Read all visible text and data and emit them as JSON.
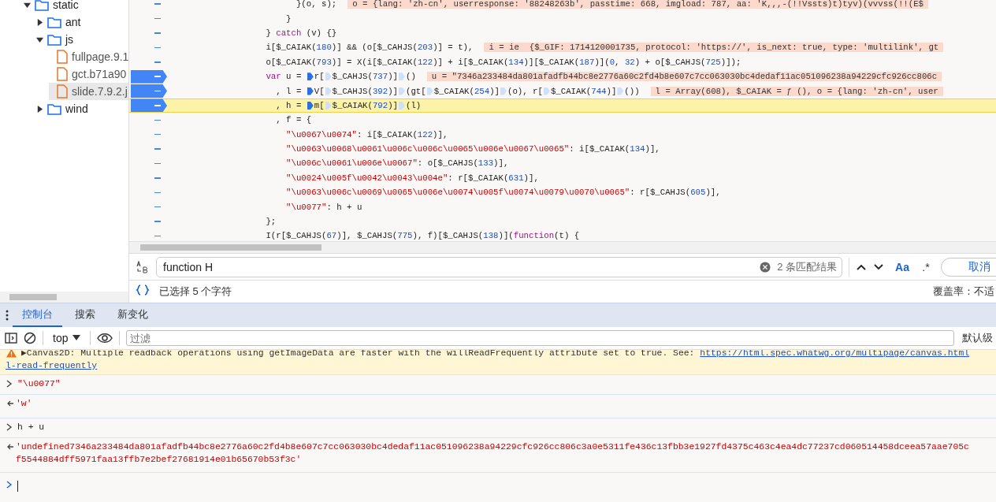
{
  "file_tree": [
    {
      "name": "static",
      "kind": "folder",
      "expanded": true,
      "children": [
        {
          "name": "ant",
          "kind": "folder",
          "expanded": false
        },
        {
          "name": "js",
          "kind": "folder",
          "expanded": true,
          "children": [
            {
              "name": "fullpage.9.1",
              "kind": "file",
              "selected": false
            },
            {
              "name": "gct.b71a90",
              "kind": "file",
              "selected": false
            },
            {
              "name": "slide.7.9.2.j",
              "kind": "file",
              "selected": true
            }
          ]
        },
        {
          "name": "wind",
          "kind": "folder",
          "expanded": false
        }
      ]
    }
  ],
  "code_lines": [
    {
      "tokens": [
        {
          "kind": "text",
          "text": "                        }(o, s);"
        }
      ],
      "inline": "o = {lang: 'zh-cn', userresponse: '88248263b', passtime: 668, imgload: 787, aa: 'K,,,-(!!Vssts)t)tyv)(vvvss(!!(E$",
      "breakpoint": false,
      "highlighted": false
    },
    {
      "tokens": [
        {
          "kind": "text",
          "text": "                      }"
        }
      ],
      "breakpoint": false,
      "highlighted": false
    },
    {
      "tokens": [
        {
          "kind": "text",
          "text": "                  } "
        },
        {
          "kind": "keyword",
          "text": "catch"
        },
        {
          "kind": "text",
          "text": " (v) {}"
        }
      ],
      "breakpoint": false,
      "highlighted": false
    },
    {
      "tokens": [
        {
          "kind": "text",
          "text": "                  i[$_CAIAK("
        },
        {
          "kind": "number",
          "text": "180"
        },
        {
          "kind": "text",
          "text": ")] && (o[$_CAHJS("
        },
        {
          "kind": "number",
          "text": "203"
        },
        {
          "kind": "text",
          "text": ")] = t),"
        }
      ],
      "inline": "i = ie  {$_GIF: 1714120001735, protocol: 'https://', is_next: true, type: 'multilink', gt",
      "breakpoint": false,
      "highlighted": false
    },
    {
      "tokens": [
        {
          "kind": "text",
          "text": "                  o[$_CAIAK("
        },
        {
          "kind": "number",
          "text": "793"
        },
        {
          "kind": "text",
          "text": ")] = X(i[$_CAIAK("
        },
        {
          "kind": "number",
          "text": "122"
        },
        {
          "kind": "text",
          "text": ")] + i[$_CAIAK("
        },
        {
          "kind": "number",
          "text": "134"
        },
        {
          "kind": "text",
          "text": ")][$_CAIAK("
        },
        {
          "kind": "number",
          "text": "187"
        },
        {
          "kind": "text",
          "text": ")]("
        },
        {
          "kind": "number",
          "text": "0"
        },
        {
          "kind": "text",
          "text": ", "
        },
        {
          "kind": "number",
          "text": "32"
        },
        {
          "kind": "text",
          "text": ") + o[$_CAHJS("
        },
        {
          "kind": "number",
          "text": "725"
        },
        {
          "kind": "text",
          "text": ")]);"
        }
      ],
      "breakpoint": false,
      "highlighted": false
    },
    {
      "tokens": [
        {
          "kind": "keyword",
          "text": "                  var"
        },
        {
          "kind": "text",
          "text": " u = "
        },
        {
          "kind": "step"
        },
        {
          "kind": "text",
          "text": "r["
        },
        {
          "kind": "call-step"
        },
        {
          "kind": "text",
          "text": "$_CAHJS("
        },
        {
          "kind": "number",
          "text": "737"
        },
        {
          "kind": "text",
          "text": ")]"
        },
        {
          "kind": "call-step"
        },
        {
          "kind": "text",
          "text": "()"
        }
      ],
      "inline": "u = \"7346a233484da801afadfb44bc8e2776a60c2fd4b8e607c7cc063030bc4dedaf11ac051096238a94229cfc926cc806c",
      "breakpoint": true,
      "highlighted": false
    },
    {
      "tokens": [
        {
          "kind": "text",
          "text": "                    , l = "
        },
        {
          "kind": "step"
        },
        {
          "kind": "text",
          "text": "V["
        },
        {
          "kind": "call-step"
        },
        {
          "kind": "text",
          "text": "$_CAHJS("
        },
        {
          "kind": "number",
          "text": "392"
        },
        {
          "kind": "text",
          "text": ")]"
        },
        {
          "kind": "call-step"
        },
        {
          "kind": "text",
          "text": "(gt["
        },
        {
          "kind": "call-step"
        },
        {
          "kind": "text",
          "text": "$_CAIAK("
        },
        {
          "kind": "number",
          "text": "254"
        },
        {
          "kind": "text",
          "text": ")]"
        },
        {
          "kind": "call-step"
        },
        {
          "kind": "text",
          "text": "(o), r["
        },
        {
          "kind": "call-step"
        },
        {
          "kind": "text",
          "text": "$_CAIAK("
        },
        {
          "kind": "number",
          "text": "744"
        },
        {
          "kind": "text",
          "text": ")]"
        },
        {
          "kind": "call-step"
        },
        {
          "kind": "text",
          "text": "())"
        }
      ],
      "inline": "l = Array(608), $_CAIAK = ƒ (), o = {lang: 'zh-cn', user",
      "breakpoint": true,
      "highlighted": false
    },
    {
      "tokens": [
        {
          "kind": "text",
          "text": "                    , h = "
        },
        {
          "kind": "step"
        },
        {
          "kind": "text",
          "text": "m["
        },
        {
          "kind": "call-step"
        },
        {
          "kind": "text",
          "text": "$_CAIAK("
        },
        {
          "kind": "number",
          "text": "792"
        },
        {
          "kind": "text",
          "text": ")]"
        },
        {
          "kind": "call-step"
        },
        {
          "kind": "text",
          "text": "(l)"
        }
      ],
      "breakpoint": true,
      "highlighted": true
    },
    {
      "tokens": [
        {
          "kind": "text",
          "text": "                    , f = {"
        }
      ],
      "breakpoint": false,
      "highlighted": false
    },
    {
      "tokens": [
        {
          "kind": "string",
          "text": "                      \"\\u0067\\u0074\""
        },
        {
          "kind": "text",
          "text": ": i[$_CAIAK("
        },
        {
          "kind": "number",
          "text": "122"
        },
        {
          "kind": "text",
          "text": ")],"
        }
      ],
      "breakpoint": false,
      "highlighted": false
    },
    {
      "tokens": [
        {
          "kind": "string",
          "text": "                      \"\\u0063\\u0068\\u0061\\u006c\\u006c\\u0065\\u006e\\u0067\\u0065\""
        },
        {
          "kind": "text",
          "text": ": i[$_CAIAK("
        },
        {
          "kind": "number",
          "text": "134"
        },
        {
          "kind": "text",
          "text": ")],"
        }
      ],
      "breakpoint": false,
      "highlighted": false
    },
    {
      "tokens": [
        {
          "kind": "string",
          "text": "                      \"\\u006c\\u0061\\u006e\\u0067\""
        },
        {
          "kind": "text",
          "text": ": o[$_CAHJS("
        },
        {
          "kind": "number",
          "text": "133"
        },
        {
          "kind": "text",
          "text": ")],"
        }
      ],
      "breakpoint": false,
      "highlighted": false
    },
    {
      "tokens": [
        {
          "kind": "string",
          "text": "                      \"\\u0024\\u005f\\u0042\\u0043\\u004e\""
        },
        {
          "kind": "text",
          "text": ": r[$_CAIAK("
        },
        {
          "kind": "number",
          "text": "631"
        },
        {
          "kind": "text",
          "text": ")],"
        }
      ],
      "breakpoint": false,
      "highlighted": false
    },
    {
      "tokens": [
        {
          "kind": "string",
          "text": "                      \"\\u0063\\u006c\\u0069\\u0065\\u006e\\u0074\\u005f\\u0074\\u0079\\u0070\\u0065\""
        },
        {
          "kind": "text",
          "text": ": r[$_CAHJS("
        },
        {
          "kind": "number",
          "text": "605"
        },
        {
          "kind": "text",
          "text": ")],"
        }
      ],
      "breakpoint": false,
      "highlighted": false
    },
    {
      "tokens": [
        {
          "kind": "string",
          "text": "                      \"\\u0077\""
        },
        {
          "kind": "text",
          "text": ": h + u"
        }
      ],
      "breakpoint": false,
      "highlighted": false
    },
    {
      "tokens": [
        {
          "kind": "text",
          "text": "                  };"
        }
      ],
      "breakpoint": false,
      "highlighted": false
    },
    {
      "tokens": [
        {
          "kind": "text",
          "text": "                  I(r[$_CAHJS("
        },
        {
          "kind": "number",
          "text": "67"
        },
        {
          "kind": "text",
          "text": ")], $_CAHJS("
        },
        {
          "kind": "number",
          "text": "775"
        },
        {
          "kind": "text",
          "text": "), f)[$_CAHJS("
        },
        {
          "kind": "number",
          "text": "138"
        },
        {
          "kind": "text",
          "text": ")]("
        },
        {
          "kind": "keyword",
          "text": "function"
        },
        {
          "kind": "text",
          "text": "(t) {"
        }
      ],
      "breakpoint": false,
      "highlighted": false
    }
  ],
  "search": {
    "value": "function H",
    "match_count": "2 条匹配结果",
    "case_button": "Aa",
    "regex_button": ".*",
    "cancel_button": "取消"
  },
  "status": {
    "selection": "已选择 5 个字符",
    "coverage": "覆盖率：不适"
  },
  "console_tabs": [
    {
      "label": "控制台",
      "selected": true
    },
    {
      "label": "搜索",
      "selected": false
    },
    {
      "label": "新变化",
      "selected": false
    }
  ],
  "console_toolbar": {
    "context": "top",
    "filter_placeholder": "过滤",
    "levels": "默认级"
  },
  "messages": [
    {
      "kind": "warning",
      "text": "▶Canvas2D: Multiple readback operations using getImageData are faster with the willReadFrequently attribute set to true. See: ",
      "link": "https://html.spec.whatwg.org/multipage/canvas.html",
      "link_continued": "l-read-frequently"
    },
    {
      "kind": "string-input",
      "text": "\"\\u0077\""
    },
    {
      "kind": "output",
      "lines": [
        "'w'"
      ]
    },
    {
      "kind": "input",
      "text": "h + u"
    },
    {
      "kind": "output",
      "lines": [
        "'undefined7346a233484da801afadfb44bc8e2776a60c2fd4b8e607c7cc063030bc4dedaf11ac051096238a94229cfc926cc806c3a0e5311fe436c13fbb3e1927fd4375c463c4ea4dc77237cd060514458dceea57aae705c",
        "f5544884dff5971faa13ffb7e2bef27681914e01b65670b53f3c'"
      ]
    },
    {
      "kind": "prompt"
    }
  ]
}
